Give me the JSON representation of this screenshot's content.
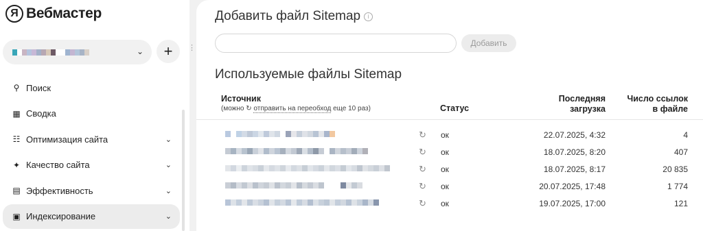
{
  "app": {
    "logo_mark": "Я",
    "logo_text": "Вебмастер"
  },
  "sidebar": {
    "add_site_label": "+",
    "items": [
      {
        "label": "Поиск",
        "icon": "search-icon",
        "has_chevron": false
      },
      {
        "label": "Сводка",
        "icon": "dashboard-grid-icon",
        "has_chevron": true
      },
      {
        "label": "Оптимизация сайта",
        "icon": "site-structure-icon",
        "has_chevron": true
      },
      {
        "label": "Качество сайта",
        "icon": "sparkle-icon",
        "has_chevron": true
      },
      {
        "label": "Эффективность",
        "icon": "bar-chart-icon",
        "has_chevron": true
      },
      {
        "label": "Индексирование",
        "icon": "indexing-monitor-icon",
        "has_chevron": true,
        "active": true
      }
    ]
  },
  "main": {
    "add_title": "Добавить файл Sitemap",
    "input_value": "",
    "input_placeholder": "",
    "add_button": "Добавить",
    "used_title": "Используемые файлы Sitemap",
    "table": {
      "col_source": "Источник",
      "col_source_note_prefix": "(можно",
      "col_source_note_link": "отправить на переобход",
      "col_source_note_suffix": "еще 10 раз)",
      "col_status": "Статус",
      "col_loaded_1": "Последняя",
      "col_loaded_2": "загрузка",
      "col_links_1": "Число ссылок",
      "col_links_2": "в файле",
      "rows": [
        {
          "status": "ок",
          "loaded": "22.07.2025, 4:32",
          "links": "4"
        },
        {
          "status": "ок",
          "loaded": "18.07.2025, 8:20",
          "links": "407"
        },
        {
          "status": "ок",
          "loaded": "18.07.2025, 8:17",
          "links": "20 835"
        },
        {
          "status": "ок",
          "loaded": "20.07.2025, 17:48",
          "links": "1 774"
        },
        {
          "status": "ок",
          "loaded": "19.07.2025, 17:00",
          "links": "121"
        }
      ]
    }
  },
  "colors": {
    "sidebar_bg": "#ffffff",
    "page_bg": "#f1f1f1",
    "active_nav_bg": "#ececec",
    "muted_button_text": "#9a9a9a"
  }
}
